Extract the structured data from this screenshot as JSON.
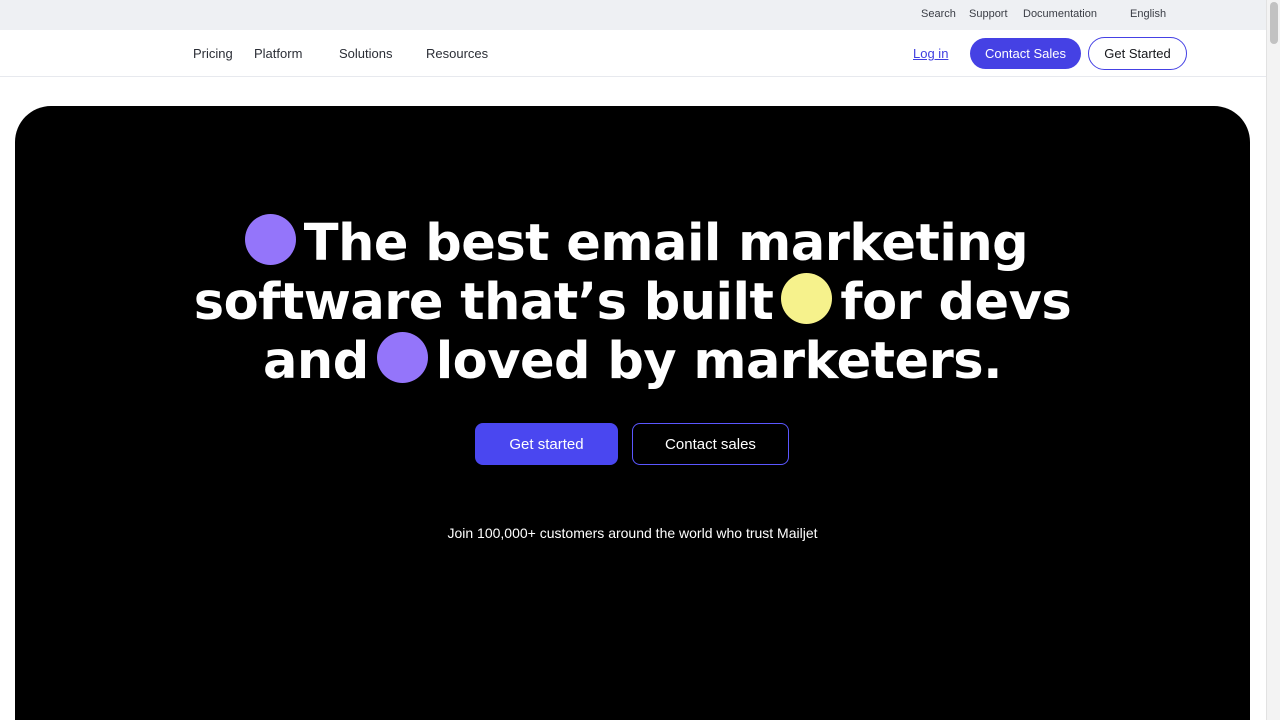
{
  "utility_nav": {
    "search": "Search",
    "support": "Support",
    "documentation": "Documentation",
    "language": "English"
  },
  "main_nav": {
    "items": [
      "Pricing",
      "Platform",
      "Solutions",
      "Resources"
    ],
    "login": "Log in",
    "contact_sales": "Contact Sales",
    "get_started": "Get Started"
  },
  "hero": {
    "headline_lines": [
      "The best email marketing",
      "software that’s built",
      "for devs",
      "and",
      "loved by marketers."
    ],
    "primary_cta": "Get started",
    "secondary_cta": "Contact sales",
    "tagline": "Join 100,000+ customers around the world who trust Mailjet"
  },
  "colors": {
    "accent": "#4541e4",
    "hero_background": "#000000",
    "dot_purple": "#9475fa",
    "dot_yellow": "#f6f28c"
  },
  "icons": {
    "decorative_dots": [
      "purple-dot-icon",
      "yellow-dot-icon",
      "purple-dot-icon"
    ]
  }
}
